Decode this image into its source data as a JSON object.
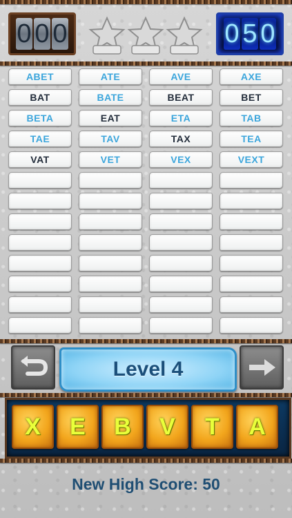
{
  "header": {
    "left_counter": [
      "0",
      "0",
      "0"
    ],
    "right_counter": [
      "0",
      "5",
      "0"
    ],
    "stars": [
      "star-1",
      "star-2",
      "star-3"
    ]
  },
  "words": {
    "columns": 4,
    "rows": 13,
    "found": [
      {
        "text": "ABET",
        "color": "blue"
      },
      {
        "text": "ATE",
        "color": "blue"
      },
      {
        "text": "AVE",
        "color": "blue"
      },
      {
        "text": "AXE",
        "color": "blue"
      },
      {
        "text": "BAT",
        "color": "dark"
      },
      {
        "text": "BATE",
        "color": "blue"
      },
      {
        "text": "BEAT",
        "color": "dark"
      },
      {
        "text": "BET",
        "color": "dark"
      },
      {
        "text": "BETA",
        "color": "blue"
      },
      {
        "text": "EAT",
        "color": "dark"
      },
      {
        "text": "ETA",
        "color": "blue"
      },
      {
        "text": "TAB",
        "color": "blue"
      },
      {
        "text": "TAE",
        "color": "blue"
      },
      {
        "text": "TAV",
        "color": "blue"
      },
      {
        "text": "TAX",
        "color": "dark"
      },
      {
        "text": "TEA",
        "color": "blue"
      },
      {
        "text": "VAT",
        "color": "dark"
      },
      {
        "text": "VET",
        "color": "blue"
      },
      {
        "text": "VEX",
        "color": "blue"
      },
      {
        "text": "VEXT",
        "color": "blue"
      }
    ],
    "colors": {
      "blue": "#3aa5dc",
      "dark": "#222c3a"
    }
  },
  "controls": {
    "level_label": "Level 4",
    "back_icon": "curved-arrow-icon",
    "next_icon": "right-arrow-icon"
  },
  "tiles": [
    "X",
    "E",
    "B",
    "V",
    "T",
    "A"
  ],
  "footer": {
    "score_text": "New High Score: 50"
  }
}
